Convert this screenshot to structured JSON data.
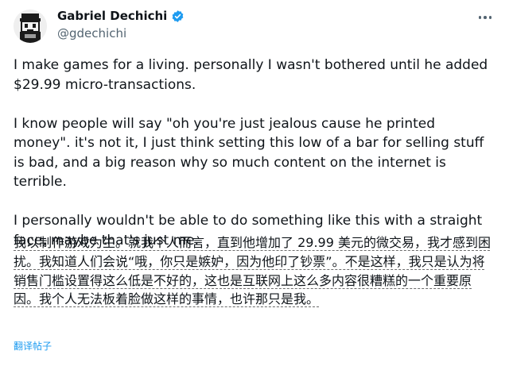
{
  "author": {
    "name": "Gabriel Dechichi",
    "handle": "@gdechichi",
    "verified_icon": "verified-badge-icon",
    "avatar_icon": "pixel-art-avatar-icon"
  },
  "menu": {
    "more_icon": "more-options-icon"
  },
  "tweet": {
    "text": "I make games for a living. personally I wasn't bothered until he added $29.99 micro-transactions.\n\nI know people will say \"oh you're just jealous cause he printed money\". it's not it, I just think setting this low of a bar for selling stuff is bad, and a big reason why so much content on the internet is terrible.\n\nI personally wouldn't be able to do something like this with a straight face, maybe that's just me."
  },
  "translation": {
    "text": "我以制作游戏为生。就我个人而言，直到他增加了 29.99 美元的微交易，我才感到困扰。我知道人们会说“哦，你只是嫉妒，因为他印了钞票”。不是这样，我只是认为将销售门槛设置得这么低是不好的，这也是互联网上这么多内容很糟糕的一个重要原因。我个人无法板着脸做这样的事情，也许那只是我。",
    "link_label": "翻译帖子"
  },
  "colors": {
    "link": "#1d9bf0",
    "secondary_text": "#536471",
    "verified": "#1d9bf0"
  }
}
